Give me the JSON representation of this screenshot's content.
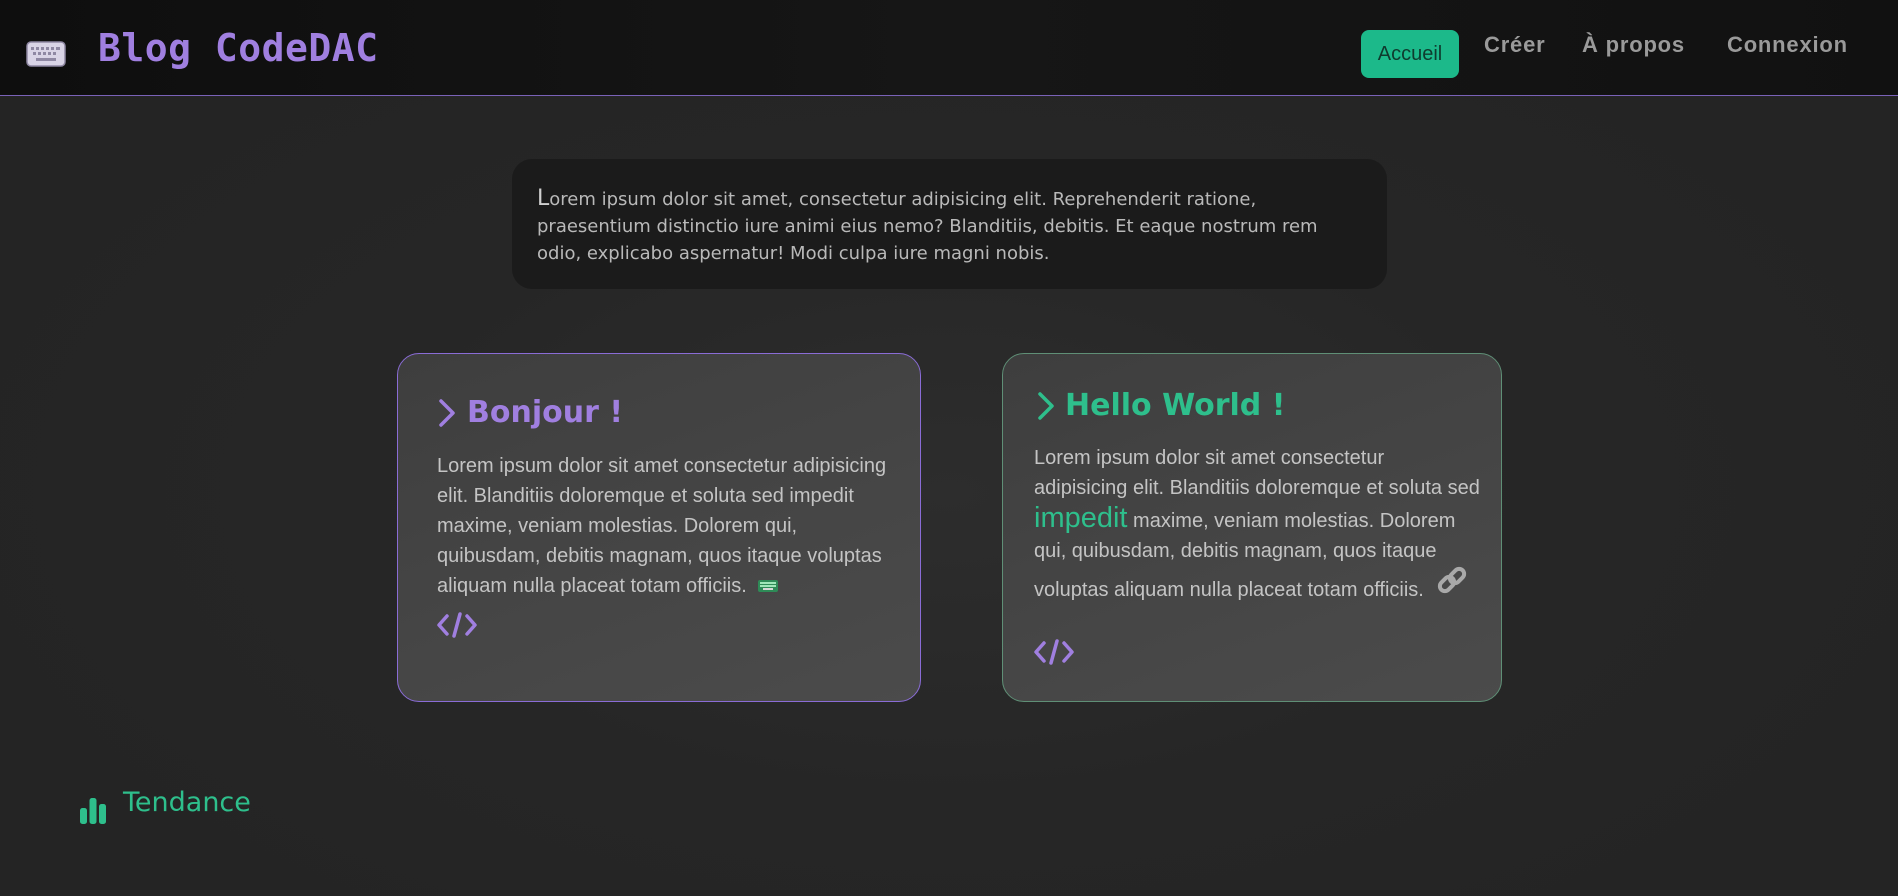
{
  "header": {
    "brand": "Blog CodeDAC",
    "brand_icon": "keyboard-icon",
    "nav": {
      "accueil": "Accueil",
      "creer": "Créer",
      "apropos": "À propos",
      "connexion": "Connexion"
    }
  },
  "intro": {
    "first_letter": "L",
    "text_rest": "orem ipsum dolor sit amet, consectetur adipisicing elit. Reprehenderit ratione, praesentium distinctio iure animi eius nemo? Blanditiis, debitis. Et eaque nostrum rem odio, explicabo aspernatur! Modi culpa iure magni nobis."
  },
  "cards": [
    {
      "title": "Bonjour !",
      "text": "Lorem ipsum dolor sit amet consectetur adipisicing elit. Blanditiis doloremque et soluta sed impedit maxime, veniam molestias. Dolorem qui, quibusdam, debitis magnam, quos itaque voluptas aliquam nulla placeat totam officiis.",
      "accent": "#a07fe0"
    },
    {
      "title": "Hello World !",
      "text_before": "Lorem ipsum dolor sit amet consectetur adipisicing elit. Blanditiis doloremque et soluta sed ",
      "highlight": "impedit",
      "text_after": " maxime, veniam molestias. Dolorem qui, quibusdam, debitis magnam, quos itaque voluptas aliquam nulla placeat totam officiis.",
      "accent": "#2ebf8c"
    }
  ],
  "trend": {
    "label": "Tendance"
  }
}
